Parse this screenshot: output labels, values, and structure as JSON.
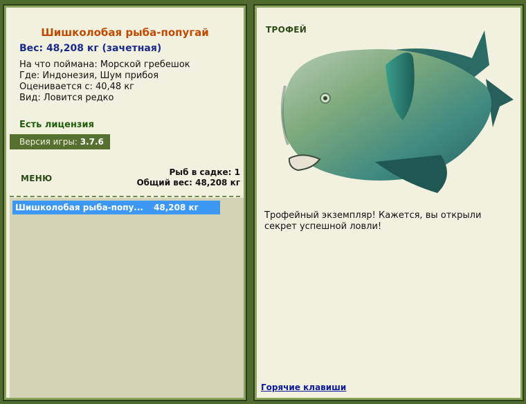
{
  "left": {
    "fish_name": "Шишколобая рыба-попугай",
    "weight_line": "Вес: 48,208 кг (зачетная)",
    "bait": "На что поймана: Морской гребешок",
    "location": "Где: Индонезия, Шум прибоя",
    "valued_from": "Оценивается с: 40,48 кг",
    "kind": "Вид: Ловится редко",
    "license": "Есть лицензия",
    "version_label": "Версия игры:",
    "version_value": "3.7.6",
    "menu_label": "МЕНЮ",
    "fish_in_keepnet": "Рыб в садке: 1",
    "total_weight": "Общий вес: 48,208 кг",
    "catch_list": [
      {
        "name": "Шишколобая рыба-попу...",
        "weight": "48,208 кг"
      }
    ]
  },
  "right": {
    "trophy_label": "ТРОФЕЙ",
    "fish_icon": "bumphead-parrotfish-image",
    "description": "Трофейный экземпляр! Кажется, вы открыли секрет успешной ловли!",
    "hotkeys_label": "Горячие клавиши"
  },
  "colors": {
    "frame": "#4f6b2f",
    "panel": "#f2f1e0",
    "title": "#c04a00",
    "weight": "#1a2a8a",
    "license": "#1f5f0c",
    "selected_row": "#3b97f1",
    "keepnet_bg": "#d4d3b5"
  }
}
